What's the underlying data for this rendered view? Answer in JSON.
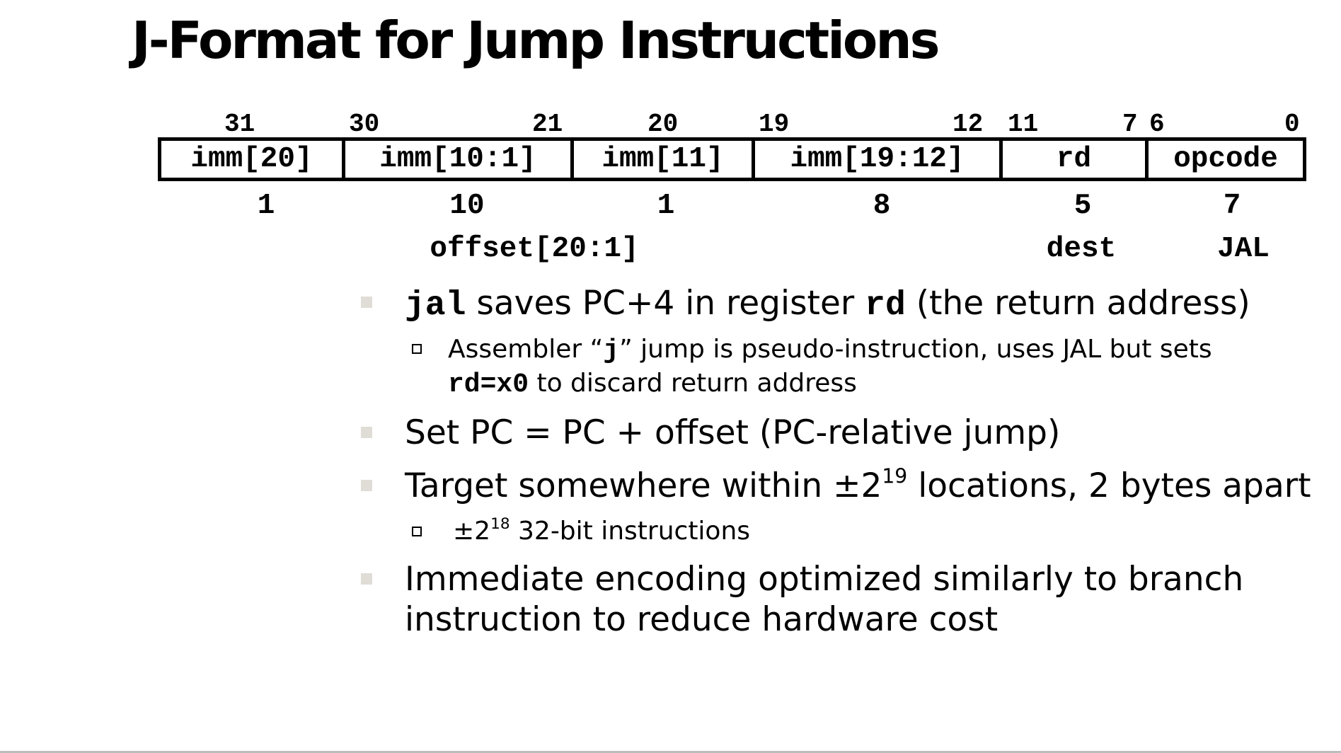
{
  "slide": {
    "title": "J-Format for Jump Instructions"
  },
  "format": {
    "bit_positions": [
      "31",
      "30",
      "21",
      "20",
      "19",
      "12",
      "11",
      "7",
      "6",
      "0"
    ],
    "fields": [
      "imm[20]",
      "imm[10:1]",
      "imm[11]",
      "imm[19:12]",
      "rd",
      "opcode"
    ],
    "widths": [
      "1",
      "10",
      "1",
      "8",
      "5",
      "7"
    ],
    "labels": [
      "offset[20:1]",
      "dest",
      "JAL"
    ]
  },
  "bullets": {
    "b1": {
      "code1": "jal",
      "text1": " saves PC+4 in register ",
      "code2": "rd",
      "text2": " (the return address)"
    },
    "b1_sub": {
      "text1": "Assembler “",
      "code1": "j",
      "text2": "” jump is pseudo-instruction, uses JAL but sets",
      "code2": "rd=x0",
      "text3": " to discard return address"
    },
    "b2": {
      "text": "Set PC = PC + offset (PC-relative jump)"
    },
    "b3": {
      "text1": "Target somewhere within  ±2",
      "sup": "19",
      "text2": " locations, 2 bytes apart"
    },
    "b3_sub": {
      "text1": " ±2",
      "sup": "18",
      "text2": " 32-bit instructions"
    },
    "b4": {
      "line1": "Immediate encoding optimized similarly to branch",
      "line2": "instruction to reduce hardware cost"
    }
  }
}
